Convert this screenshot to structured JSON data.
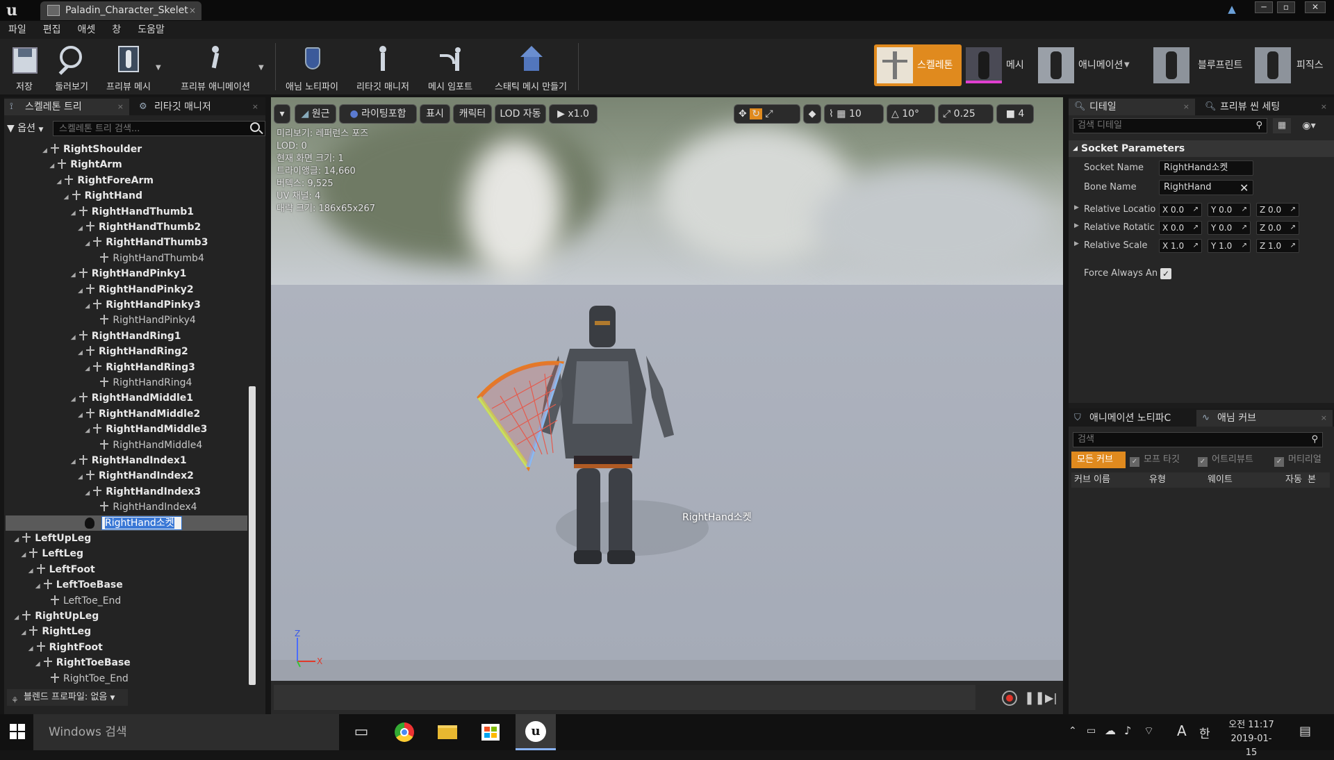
{
  "window": {
    "tab_title": "Paladin_Character_Skelet",
    "minimize": "─",
    "maximize": "▫",
    "close": "✕"
  },
  "menu": [
    "파일",
    "편집",
    "애셋",
    "창",
    "도움말"
  ],
  "toolbar": {
    "save": "저장",
    "browse": "둘러보기",
    "preview_mesh": "프리뷰 메시",
    "preview_animation": "프리뷰 애니메이션",
    "anim_notify": "애님 노티파이",
    "retarget_manager": "리타깃 매니저",
    "mesh_import": "메시 임포트",
    "make_static_mesh": "스태틱 메시 만들기"
  },
  "mode_tabs": [
    "스켈레톤",
    "메시",
    "애니메이션",
    "블루프린트",
    "피직스"
  ],
  "left_panel": {
    "tabs": [
      "스켈레톤 트리",
      "리타깃 매니저"
    ],
    "options": "옵션",
    "search_placeholder": "스켈레톤 트리 검색...",
    "bones": [
      {
        "name": "RightShoulder",
        "depth": 5,
        "leaf": false
      },
      {
        "name": "RightArm",
        "depth": 6,
        "leaf": false
      },
      {
        "name": "RightForeArm",
        "depth": 7,
        "leaf": false
      },
      {
        "name": "RightHand",
        "depth": 8,
        "leaf": false
      },
      {
        "name": "RightHandThumb1",
        "depth": 9,
        "leaf": false
      },
      {
        "name": "RightHandThumb2",
        "depth": 10,
        "leaf": false
      },
      {
        "name": "RightHandThumb3",
        "depth": 11,
        "leaf": false
      },
      {
        "name": "RightHandThumb4",
        "depth": 12,
        "leaf": true
      },
      {
        "name": "RightHandPinky1",
        "depth": 9,
        "leaf": false
      },
      {
        "name": "RightHandPinky2",
        "depth": 10,
        "leaf": false
      },
      {
        "name": "RightHandPinky3",
        "depth": 11,
        "leaf": false
      },
      {
        "name": "RightHandPinky4",
        "depth": 12,
        "leaf": true
      },
      {
        "name": "RightHandRing1",
        "depth": 9,
        "leaf": false
      },
      {
        "name": "RightHandRing2",
        "depth": 10,
        "leaf": false
      },
      {
        "name": "RightHandRing3",
        "depth": 11,
        "leaf": false
      },
      {
        "name": "RightHandRing4",
        "depth": 12,
        "leaf": true
      },
      {
        "name": "RightHandMiddle1",
        "depth": 9,
        "leaf": false
      },
      {
        "name": "RightHandMiddle2",
        "depth": 10,
        "leaf": false
      },
      {
        "name": "RightHandMiddle3",
        "depth": 11,
        "leaf": false
      },
      {
        "name": "RightHandMiddle4",
        "depth": 12,
        "leaf": true
      },
      {
        "name": "RightHandIndex1",
        "depth": 9,
        "leaf": false
      },
      {
        "name": "RightHandIndex2",
        "depth": 10,
        "leaf": false
      },
      {
        "name": "RightHandIndex3",
        "depth": 11,
        "leaf": false
      },
      {
        "name": "RightHandIndex4",
        "depth": 12,
        "leaf": true
      },
      {
        "name": "",
        "depth": 0,
        "leaf": true,
        "socket": true
      },
      {
        "name": "LeftUpLeg",
        "depth": 1,
        "leaf": false
      },
      {
        "name": "LeftLeg",
        "depth": 2,
        "leaf": false
      },
      {
        "name": "LeftFoot",
        "depth": 3,
        "leaf": false
      },
      {
        "name": "LeftToeBase",
        "depth": 4,
        "leaf": false
      },
      {
        "name": "LeftToe_End",
        "depth": 5,
        "leaf": true
      },
      {
        "name": "RightUpLeg",
        "depth": 1,
        "leaf": false
      },
      {
        "name": "RightLeg",
        "depth": 2,
        "leaf": false
      },
      {
        "name": "RightFoot",
        "depth": 3,
        "leaf": false
      },
      {
        "name": "RightToeBase",
        "depth": 4,
        "leaf": false
      },
      {
        "name": "RightToe_End",
        "depth": 5,
        "leaf": true
      }
    ],
    "socket_edit_value": "RightHand소켓",
    "blend_profile": "블렌드 프로파일: 없음"
  },
  "viewport": {
    "toolbar": {
      "perspective": "원근",
      "lighting": "라이팅포함",
      "show": "표시",
      "character": "캐릭터",
      "lod": "LOD 자동",
      "speed": "x1.0",
      "grid_snap": "10",
      "rot_snap": "10°",
      "scale_snap": "0.25",
      "camera_speed": "4"
    },
    "stats": [
      "미리보기: 레퍼런스 포즈",
      "LOD: 0",
      "현재 화면 크기: 1",
      "트라이앵글: 14,660",
      "버텍스: 9,525",
      "UV 채널: 4",
      "대략 크기: 186x65x267"
    ],
    "socket_label": "RightHand소켓",
    "axis_z": "Z",
    "axis_x": "X"
  },
  "details": {
    "tabs": [
      "디테일",
      "프리뷰 씬 세팅"
    ],
    "search_placeholder": "검색 디테일",
    "category": "Socket Parameters",
    "socket_name_label": "Socket Name",
    "socket_name_value": "RightHand소켓",
    "bone_name_label": "Bone Name",
    "bone_name_value": "RightHand",
    "rows": [
      {
        "label": "Relative Locatio",
        "x": "0.0",
        "y": "0.0",
        "z": "0.0"
      },
      {
        "label": "Relative Rotatic",
        "x": "0.0",
        "y": "0.0",
        "z": "0.0"
      },
      {
        "label": "Relative Scale",
        "x": "1.0",
        "y": "1.0",
        "z": "1.0"
      }
    ],
    "force_always_label": "Force Always An",
    "force_always_checked": true
  },
  "curves": {
    "tabs": [
      "애니메이션 노티파C",
      "애님 커브"
    ],
    "search_placeholder": "검색",
    "filters": [
      "모든 커브",
      "모프 타깃",
      "어트리뷰트",
      "머티리얼"
    ],
    "columns": [
      "커브 이름",
      "유형",
      "웨이트",
      "자동",
      "본"
    ]
  },
  "taskbar": {
    "search_placeholder": "Windows 검색",
    "time": "오전 11:17",
    "date": "2019-01-15",
    "ime_a": "A",
    "ime_han": "한"
  }
}
